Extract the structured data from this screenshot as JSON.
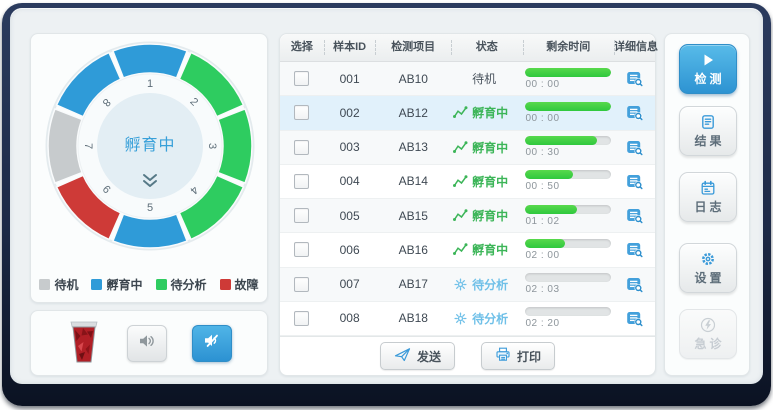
{
  "colors": {
    "accent_blue": "#2f9bd8",
    "segment_green": "#2ecc60",
    "segment_red": "#ce3a37",
    "segment_gray": "#c7cbcd",
    "progress_green": "#3fd14a",
    "status_green": "#3cb558",
    "status_blue": "#6fc0e8",
    "status_gray": "#4a545e",
    "icon_blue": "#3a9ad9",
    "row_highlight": "#e1f1fb",
    "disabled_gray": "#c9cfd4"
  },
  "dial": {
    "center_label": "孵育中",
    "expand_icon": "chevron-double-down",
    "segments": [
      {
        "num": "1",
        "color": "#2f9bd8"
      },
      {
        "num": "2",
        "color": "#2ecc60"
      },
      {
        "num": "3",
        "color": "#2ecc60"
      },
      {
        "num": "4",
        "color": "#2ecc60"
      },
      {
        "num": "5",
        "color": "#2f9bd8"
      },
      {
        "num": "6",
        "color": "#ce3a37"
      },
      {
        "num": "7",
        "color": "#c7cbcd"
      },
      {
        "num": "8",
        "color": "#2f9bd8"
      }
    ],
    "legend": [
      {
        "label": "待机",
        "color": "#c7cbcd"
      },
      {
        "label": "孵育中",
        "color": "#2f9bd8"
      },
      {
        "label": "待分析",
        "color": "#2ecc60"
      },
      {
        "label": "故障",
        "color": "#ce3a37"
      }
    ]
  },
  "sound_panel": {
    "trash_icon": "waste-bin-full",
    "sound_on_icon": "speaker",
    "sound_off_icon": "speaker-muted",
    "muted_active": true
  },
  "table": {
    "columns": [
      "选择",
      "样本ID",
      "检测项目",
      "状态",
      "剩余时间",
      "详细信息"
    ],
    "rows": [
      {
        "sample_id": "001",
        "item": "AB10",
        "status": "待机",
        "status_type": "standby",
        "progress": 100,
        "time": "00 : 00",
        "selected": false,
        "highlight": false
      },
      {
        "sample_id": "002",
        "item": "AB12",
        "status": "孵育中",
        "status_type": "incubating",
        "progress": 100,
        "time": "00 : 00",
        "selected": false,
        "highlight": true
      },
      {
        "sample_id": "003",
        "item": "AB13",
        "status": "孵育中",
        "status_type": "incubating",
        "progress": 83,
        "time": "00 : 30",
        "selected": false,
        "highlight": false
      },
      {
        "sample_id": "004",
        "item": "AB14",
        "status": "孵育中",
        "status_type": "incubating",
        "progress": 55,
        "time": "00 : 50",
        "selected": false,
        "highlight": false
      },
      {
        "sample_id": "005",
        "item": "AB15",
        "status": "孵育中",
        "status_type": "incubating",
        "progress": 60,
        "time": "01 : 02",
        "selected": false,
        "highlight": false
      },
      {
        "sample_id": "006",
        "item": "AB16",
        "status": "孵育中",
        "status_type": "incubating",
        "progress": 46,
        "time": "02 : 00",
        "selected": false,
        "highlight": false
      },
      {
        "sample_id": "007",
        "item": "AB17",
        "status": "待分析",
        "status_type": "pending",
        "progress": 0,
        "time": "02 : 03",
        "selected": false,
        "highlight": false
      },
      {
        "sample_id": "008",
        "item": "AB18",
        "status": "待分析",
        "status_type": "pending",
        "progress": 0,
        "time": "02 : 20",
        "selected": false,
        "highlight": false
      }
    ],
    "footer": {
      "send_label": "发送",
      "print_label": "打印"
    }
  },
  "side_panel": {
    "buttons": [
      {
        "id": "detect",
        "label": "检测",
        "icon": "play",
        "variant": "primary"
      },
      {
        "id": "result",
        "label": "结果",
        "icon": "report",
        "variant": "normal"
      },
      {
        "id": "log",
        "label": "日志",
        "icon": "calendar",
        "variant": "normal"
      },
      {
        "id": "settings",
        "label": "设置",
        "icon": "gear",
        "variant": "normal"
      },
      {
        "id": "emergency",
        "label": "急诊",
        "icon": "bolt",
        "variant": "disabled"
      }
    ]
  }
}
